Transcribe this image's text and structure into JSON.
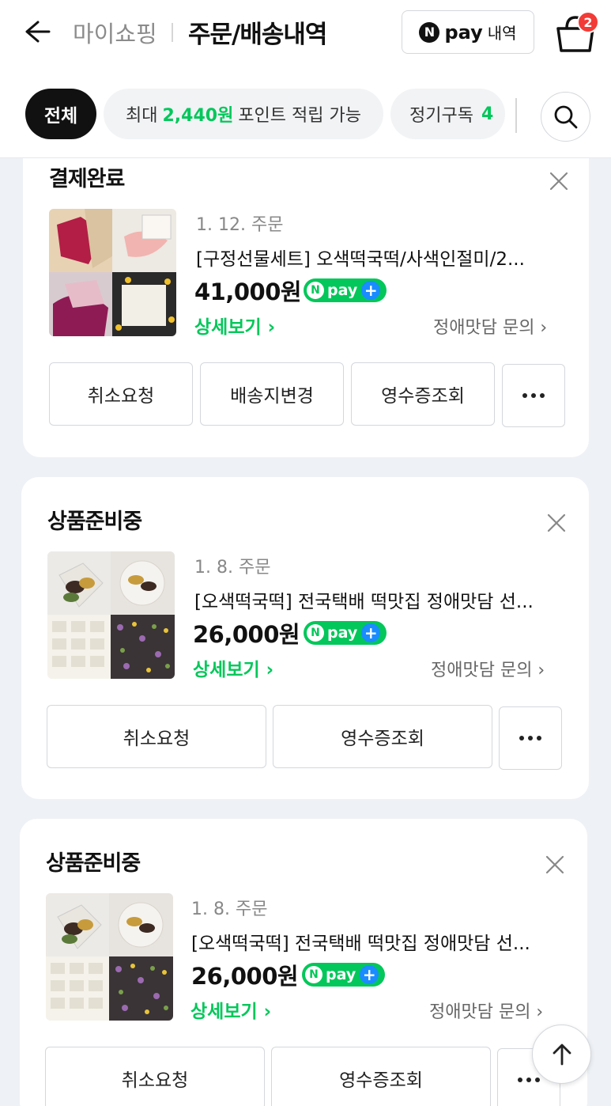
{
  "header": {
    "crumb_parent": "마이쇼핑",
    "crumb_current": "주문/배송내역",
    "npay_logo": "N",
    "npay_word": "pay",
    "npay_sub": "내역",
    "cart_count": "2"
  },
  "filters": {
    "all": "전체",
    "points_prefix": "최대",
    "points_amount": "2,440원",
    "points_suffix": "포인트 적립 가능",
    "subscription_label": "정기구독",
    "subscription_count": "4"
  },
  "orders": [
    {
      "status": "결제완료",
      "date": "1. 12. 주문",
      "name": "[구정선물세트] 오색떡국떡/사색인절미/2...",
      "price": "41,000원",
      "detail": "상세보기 ›",
      "inquiry": "정애맛담 문의 ›",
      "actions": [
        "취소요청",
        "배송지변경",
        "영수증조회"
      ]
    },
    {
      "status": "상품준비중",
      "date": "1. 8. 주문",
      "name": "[오색떡국떡] 전국택배 떡맛집 정애맛담 선...",
      "price": "26,000원",
      "detail": "상세보기 ›",
      "inquiry": "정애맛담 문의 ›",
      "actions": [
        "취소요청",
        "영수증조회"
      ]
    },
    {
      "status": "상품준비중",
      "date": "1. 8. 주문",
      "name": "[오색떡국떡] 전국택배 떡맛집 정애맛담 선...",
      "price": "26,000원",
      "detail": "상세보기 ›",
      "inquiry": "정애맛담 문의 ›",
      "actions": [
        "취소요청",
        "영수증조회"
      ]
    }
  ],
  "npay_plus": {
    "n": "N",
    "word": "pay",
    "plus": "+"
  },
  "colors": {
    "accent": "#03c75a",
    "badge": "#f23b36",
    "npay_blue": "#1a8cff"
  }
}
